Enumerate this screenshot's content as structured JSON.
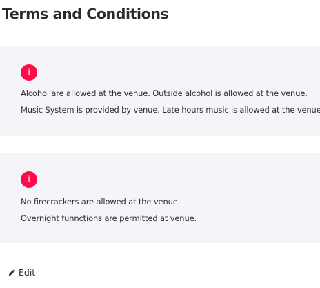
{
  "page": {
    "title": "Terms and Conditions"
  },
  "cards": [
    {
      "icon": "info-icon",
      "icon_glyph": "i",
      "lines": [
        "Alcohol are allowed at the venue. Outside alcohol is allowed at the venue.",
        "Music System is provided by venue. Late hours music is allowed at the venue."
      ]
    },
    {
      "icon": "info-icon",
      "icon_glyph": "i",
      "lines": [
        "No firecrackers are allowed at the venue.",
        "Overnight funnctions are permitted at venue."
      ]
    }
  ],
  "actions": {
    "edit_label": "Edit",
    "edit_icon": "pencil-icon"
  },
  "colors": {
    "accent": "#ff0b4a",
    "card_background": "#f5f4f8",
    "text": "#2f2f2f"
  }
}
